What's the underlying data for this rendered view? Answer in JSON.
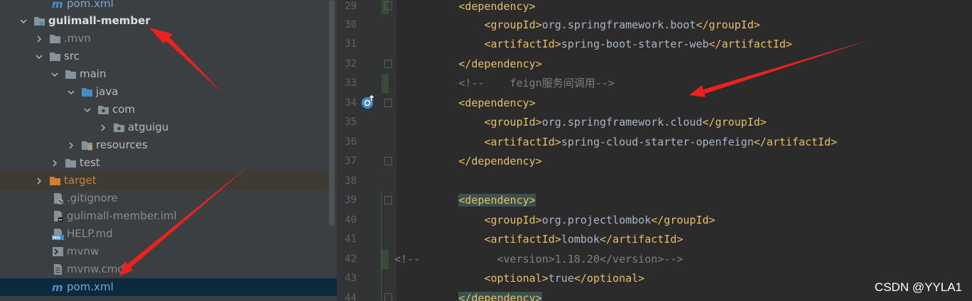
{
  "tree": {
    "items": [
      {
        "label": "pom.xml"
      },
      {
        "label": "gulimall-member"
      },
      {
        "label": ".mvn"
      },
      {
        "label": "src"
      },
      {
        "label": "main"
      },
      {
        "label": "java"
      },
      {
        "label": "com"
      },
      {
        "label": "atguigu"
      },
      {
        "label": "resources"
      },
      {
        "label": "test"
      },
      {
        "label": "target"
      },
      {
        "label": ".gitignore"
      },
      {
        "label": "gulimall-member.iml"
      },
      {
        "label": "HELP.md"
      },
      {
        "label": "mvnw"
      },
      {
        "label": "mvnw.cmd"
      },
      {
        "label": "pom.xml"
      }
    ]
  },
  "editor": {
    "line_numbers": [
      "29",
      "30",
      "31",
      "32",
      "33",
      "34",
      "35",
      "36",
      "37",
      "38",
      "39",
      "40",
      "41",
      "42",
      "43",
      "44"
    ],
    "lines": [
      {
        "t1": "<dependency>"
      },
      {
        "t1": "<groupId>",
        "t2": "org.springframework.boot",
        "t3": "</groupId>"
      },
      {
        "t1": "<artifactId>",
        "t2": "spring-boot-starter-web",
        "t3": "</artifactId>"
      },
      {
        "t1": "</dependency>"
      },
      {
        "c": "<!--    feign服务间调用-->"
      },
      {
        "t1": "<dependency>"
      },
      {
        "t1": "<groupId>",
        "t2": "org.springframework.cloud",
        "t3": "</groupId>"
      },
      {
        "t1": "<artifactId>",
        "t2": "spring-cloud-starter-openfeign",
        "t3": "</artifactId>"
      },
      {
        "t1": "</dependency>"
      },
      {},
      {
        "t1": "<dependency>"
      },
      {
        "t1": "<groupId>",
        "t2": "org.projectlombok",
        "t3": "</groupId>"
      },
      {
        "t1": "<artifactId>",
        "t2": "lombok",
        "t3": "</artifactId>"
      },
      {
        "c": "<!--            <version>1.18.20</version>-->"
      },
      {
        "t1": "<optional>",
        "t2": "true",
        "t3": "</optional>"
      },
      {
        "t1": "</dependency>"
      }
    ]
  },
  "watermark": "CSDN @YYLA1",
  "colors": {
    "tree_bg": "#3c3f41",
    "editor_bg": "#2b2b2b",
    "tag": "#e8bf6a",
    "text": "#a9b7c6",
    "comment": "#808080",
    "arrow": "#f0201c",
    "selection": "#0d293e"
  },
  "icons": [
    "maven-icon",
    "module-folder-icon",
    "folder-icon",
    "source-folder-icon",
    "package-icon",
    "resources-folder-icon",
    "excluded-folder-icon",
    "gitignore-file-icon",
    "iml-file-icon",
    "markdown-file-icon",
    "shell-script-icon",
    "text-file-icon",
    "override-gutter-icon"
  ]
}
